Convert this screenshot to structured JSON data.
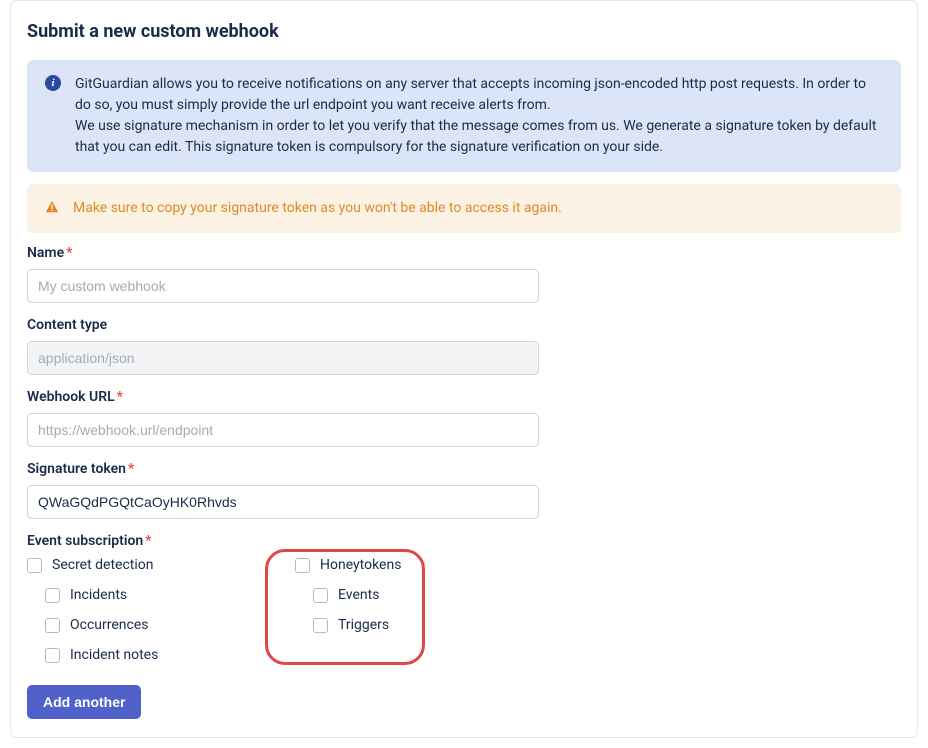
{
  "heading": "Submit a new custom webhook",
  "info_alert": {
    "line1": "GitGuardian allows you to receive notifications on any server that accepts incoming json-encoded http post requests. In order to do so, you must simply provide the url endpoint you want receive alerts from.",
    "line2": "We use signature mechanism in order to let you verify that the message comes from us. We generate a signature token by default that you can edit. This signature token is compulsory for the signature verification on your side."
  },
  "warning_alert": "Make sure to copy your signature token as you won't be able to access it again.",
  "fields": {
    "name": {
      "label": "Name",
      "placeholder": "My custom webhook",
      "required": true
    },
    "content_type": {
      "label": "Content type",
      "value": "application/json",
      "required": false
    },
    "webhook_url": {
      "label": "Webhook URL",
      "placeholder": "https://webhook.url/endpoint",
      "required": true
    },
    "signature_token": {
      "label": "Signature token",
      "value": "QWaGQdPGQtCaOyHK0Rhvds",
      "required": true
    },
    "event_subscription": {
      "label": "Event subscription",
      "required": true
    }
  },
  "events": {
    "left": {
      "parent": "Secret detection",
      "children": [
        "Incidents",
        "Occurrences",
        "Incident notes"
      ]
    },
    "right": {
      "parent": "Honeytokens",
      "children": [
        "Events",
        "Triggers"
      ]
    }
  },
  "button": "Add another"
}
